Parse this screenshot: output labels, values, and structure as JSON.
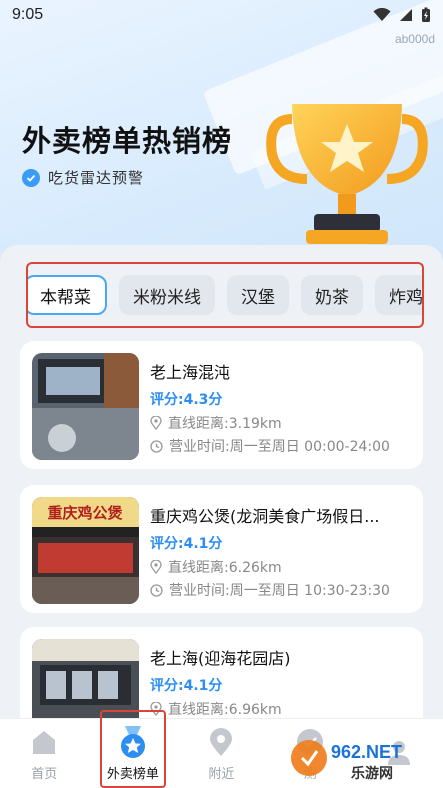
{
  "status_bar": {
    "time": "9:05",
    "device_id": "ab000d"
  },
  "hero": {
    "title": "外卖榜单热销榜",
    "subtitle": "吃货雷达预警"
  },
  "tabs": [
    {
      "label": "本帮菜",
      "active": true
    },
    {
      "label": "米粉米线",
      "active": false
    },
    {
      "label": "汉堡",
      "active": false
    },
    {
      "label": "奶茶",
      "active": false
    },
    {
      "label": "炸鸡",
      "active": false
    }
  ],
  "shops": [
    {
      "name": "老上海混沌",
      "score": "评分:4.3分",
      "distance": "直线距离:3.19km",
      "hours": "营业时间:周一至周日 00:00-24:00"
    },
    {
      "name": "重庆鸡公煲(龙洞美食广场假日...",
      "score": "评分:4.1分",
      "distance": "直线距离:6.26km",
      "hours": "营业时间:周一至周日 10:30-23:30",
      "sign_text": "重庆鸡公煲"
    },
    {
      "name": "老上海(迎海花园店)",
      "score": "评分:4.1分",
      "distance": "直线距离:6.96km",
      "hours": ""
    }
  ],
  "bottom_nav": [
    {
      "label": "首页",
      "icon": "home-icon",
      "active": false
    },
    {
      "label": "外卖榜单",
      "icon": "medal-icon",
      "active": true
    },
    {
      "label": "附近",
      "icon": "location-icon",
      "active": false
    },
    {
      "label": "测",
      "icon": "check-icon",
      "active": false
    },
    {
      "label": "",
      "icon": "user-icon",
      "active": false
    }
  ],
  "watermark": {
    "text1": "962.NET",
    "text2": "乐游网"
  },
  "colors": {
    "accent": "#2b8ef0",
    "highlight": "#d9453a"
  }
}
